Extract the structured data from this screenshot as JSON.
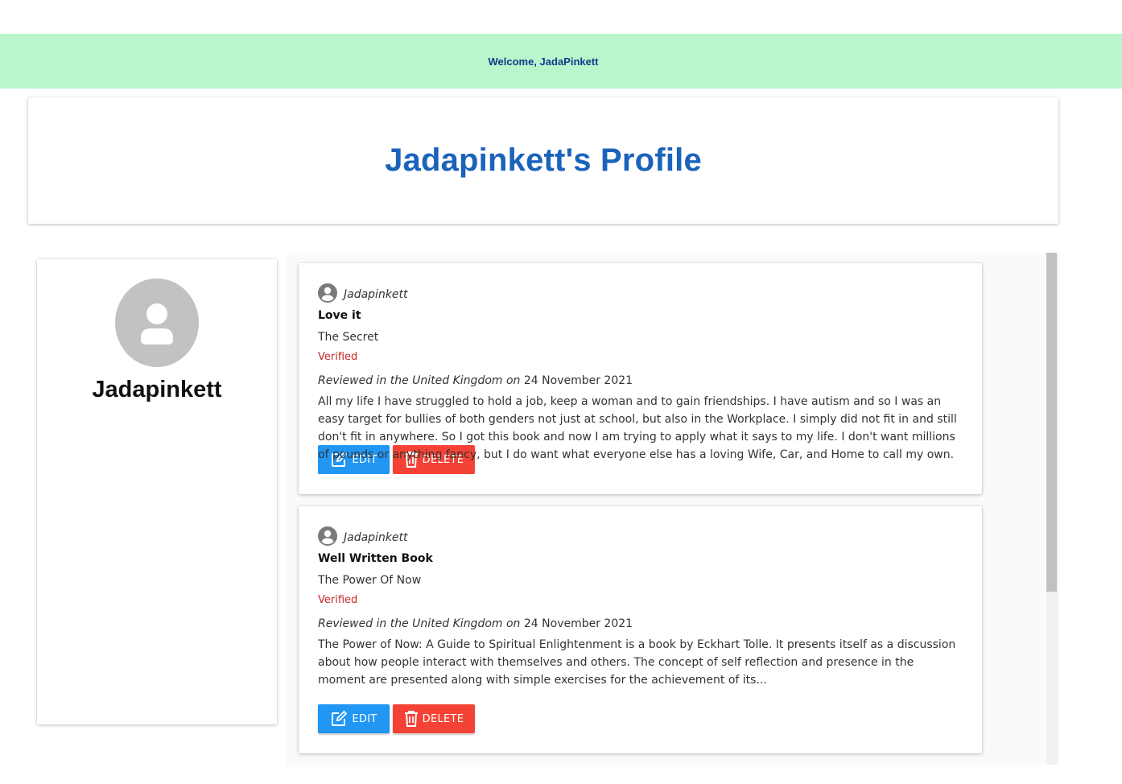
{
  "header": {
    "welcome": "Welcome, JadaPinkett"
  },
  "page": {
    "title": "Jadapinkett's Profile"
  },
  "profile": {
    "name": "Jadapinkett",
    "avatar_icon": "person-icon"
  },
  "reviews": [
    {
      "author": "Jadapinkett",
      "title": "Love it",
      "book": "The Secret",
      "verified": "Verified",
      "reviewed_in": "Reviewed in the United Kingdom on",
      "date": "24 November 2021",
      "body": "All my life I have struggled to hold a job, keep a woman and to gain friendships. I have autism and so I was an easy target for bullies of both genders not just at school, but also in the Workplace. I simply did not fit in and still don't fit in anywhere. So I got this book and now I am trying to apply what it says to my life. I don't want millions of pounds or anything fancy, but I do want what everyone else has a loving Wife, Car, and Home to call my own. These I believe by the",
      "edit_label": "EDIT",
      "delete_label": "DELETE"
    },
    {
      "author": "Jadapinkett",
      "title": "Well Written Book",
      "book": "The Power Of Now",
      "verified": "Verified",
      "reviewed_in": "Reviewed in the United Kingdom on",
      "date": "24 November 2021",
      "body": "The Power of Now: A Guide to Spiritual Enlightenment is a book by Eckhart Tolle. It presents itself as a discussion about how people interact with themselves and others. The concept of self reflection and presence in the moment are presented along with simple exercises for the achievement of its...",
      "edit_label": "EDIT",
      "delete_label": "DELETE"
    }
  ],
  "colors": {
    "header_bg": "#baf5cb",
    "welcome_text": "#0d3c8c",
    "title_text": "#1a63bb",
    "verified": "#c62828",
    "edit_button": "#2196f3",
    "delete_button": "#f44336"
  }
}
